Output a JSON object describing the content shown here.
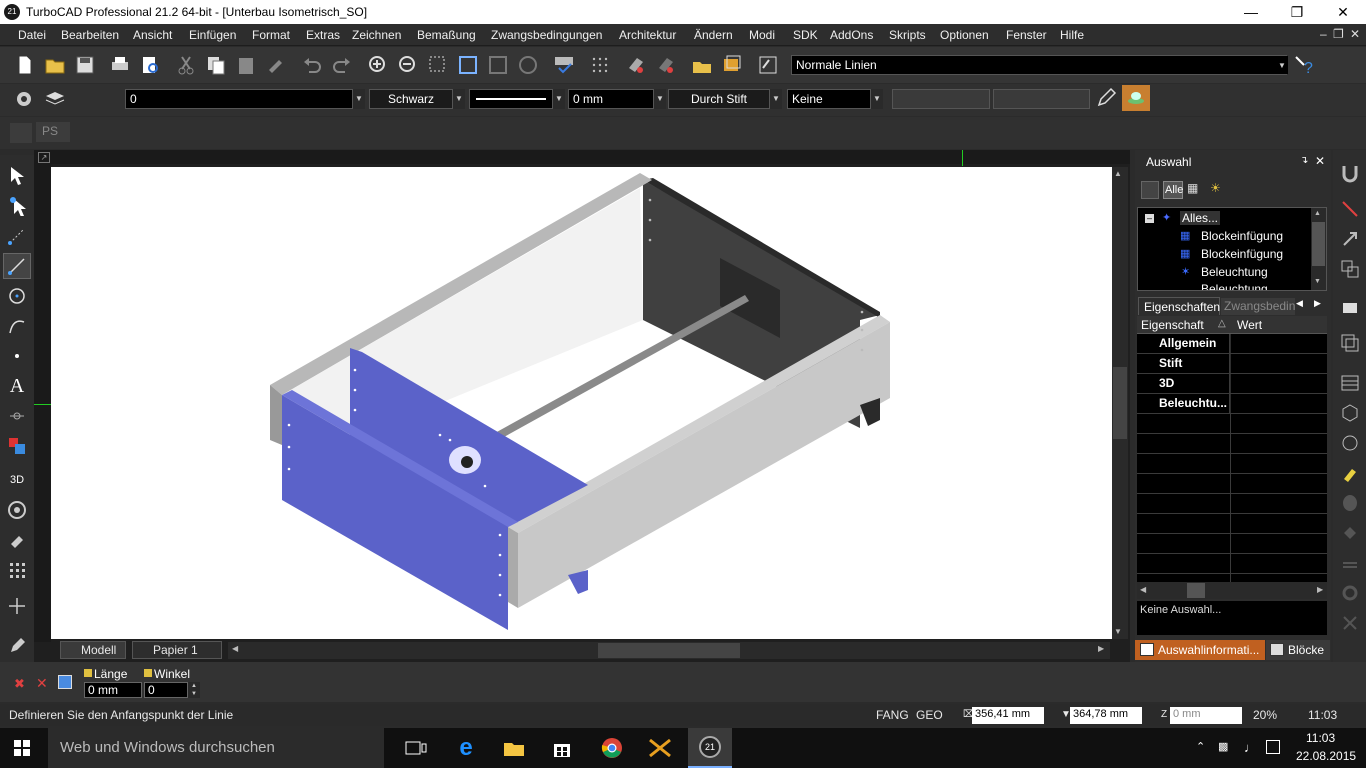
{
  "window": {
    "title": "TurboCAD Professional 21.2 64-bit - [Unterbau Isometrisch_SO]",
    "app_icon_text": "21"
  },
  "menu": [
    "Datei",
    "Bearbeiten",
    "Ansicht",
    "Einfügen",
    "Format",
    "Extras",
    "Zeichnen",
    "Bemaßung",
    "Zwangsbedingungen",
    "Architektur",
    "Ändern",
    "Modi",
    "SDK",
    "AddOns",
    "Skripts",
    "Optionen",
    "Fenster",
    "Hilfe"
  ],
  "toolbar1": {
    "line_style": "Normale Linien"
  },
  "toolbar2": {
    "layer": "0",
    "color": "Schwarz",
    "width": "0 mm",
    "pen": "Durch Stift",
    "fill": "Keine"
  },
  "toolbar3": {
    "ps_label": "PS"
  },
  "tabs": {
    "model": "Modell",
    "paper": "Papier 1"
  },
  "panel": {
    "title": "Auswahl",
    "filter_all": "Alle",
    "tree": [
      "Alles...",
      "Blockeinfügung",
      "Blockeinfügung",
      "Beleuchtung",
      "Beleuchtung"
    ],
    "tab_props": "Eigenschaften",
    "tab_constraints": "Zwangsbeding",
    "col_property": "Eigenschaft",
    "col_value": "Wert",
    "groups": [
      "Allgemein",
      "Stift",
      "3D",
      "Beleuchtu..."
    ],
    "info": "Keine Auswahl...",
    "bottom_tab1": "Auswahlinformati...",
    "bottom_tab2": "Blöcke"
  },
  "input": {
    "length_label": "Länge",
    "length_value": "0 mm",
    "angle_label": "Winkel",
    "angle_value": "0"
  },
  "status": {
    "prompt": "Definieren Sie den Anfangspunkt der Linie",
    "fang": "FANG",
    "geo": "GEO",
    "x": "356,41 mm",
    "y": "364,78 mm",
    "z": "0 mm",
    "zoom": "20%",
    "time": "11:03"
  },
  "taskbar": {
    "search": "Web und Windows durchsuchen",
    "time": "11:03",
    "date": "22.08.2015"
  },
  "colors": {
    "accent_blue": "#5b62c9",
    "panel_orange": "#c06020",
    "background": "#2d2d2d"
  }
}
